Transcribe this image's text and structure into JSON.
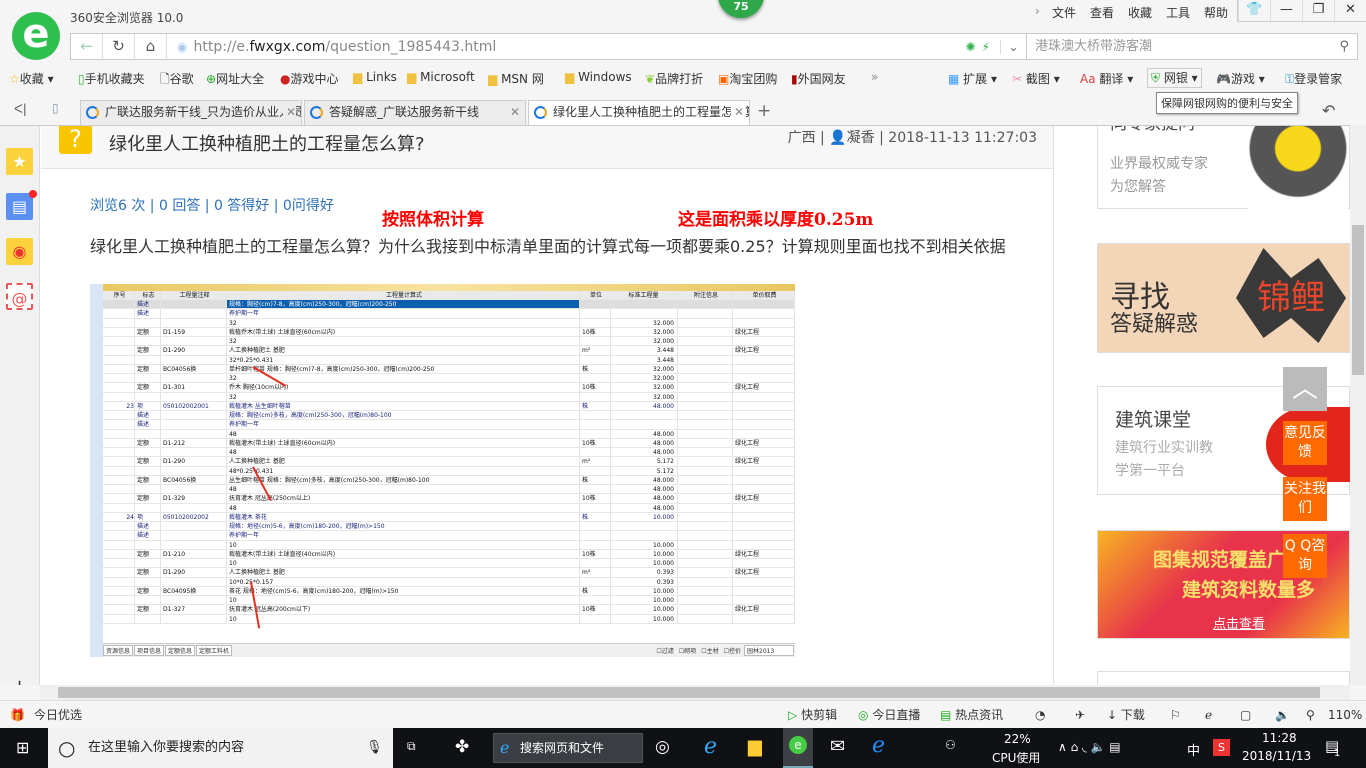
{
  "window": {
    "title": "360安全浏览器 10.0",
    "badge": "75",
    "menu": [
      "文件",
      "查看",
      "收藏",
      "工具",
      "帮助"
    ],
    "menu_arrow": "›"
  },
  "address": {
    "prefix": "http://e.",
    "domain": "fwxgx.com",
    "path": "/question_1985443.html"
  },
  "search": {
    "placeholder": "港珠澳大桥带游客潮"
  },
  "bookmarks": [
    "收藏",
    "手机收藏夹",
    "谷歌",
    "网址大全",
    "游戏中心",
    "Links",
    "Microsoft",
    "MSN 网",
    "Windows",
    "品牌打折",
    "淘宝团购",
    "外国网友"
  ],
  "extensions": [
    "扩展",
    "截图",
    "翻译",
    "网银",
    "游戏",
    "登录管家"
  ],
  "tooltip": "保障网银网购的便利与安全",
  "tabs": [
    {
      "label": "广联达服务新干线_只为造价从业人员"
    },
    {
      "label": "答疑解惑_广联达服务新干线"
    },
    {
      "label": "绿化里人工换种植肥土的工程量怎么算"
    }
  ],
  "question": {
    "title": "绿化里人工换种植肥土的工程量怎么算?",
    "region": "广西",
    "user": "凝香",
    "time": "2018-11-13 11:27:03",
    "stats": "浏览6 次 | 0 回答 | 0 答得好 | 0问得好",
    "body": "绿化里人工换种植肥土的工程量怎么算？为什么我接到中标清单里面的计算式每一项都要乘0.25？计算规则里面也找不到相关依据",
    "annotation1": "按照体积计算",
    "annotation2": "这是面积乘以厚度0.25m"
  },
  "grid": {
    "headers": [
      "序号",
      "标志",
      "工程量注释",
      "工程量计算式",
      "单位",
      "标准工程量",
      "附注信息",
      "单价取费"
    ],
    "rows": [
      [
        "",
        "描述",
        "",
        "规格：胸径(cm)7-8，高度(cm)250-300，冠幅(cm)200-250",
        "",
        "",
        "",
        ""
      ],
      [
        "",
        "描述",
        "",
        "养护期一年",
        "",
        "",
        "",
        ""
      ],
      [
        "",
        "",
        "",
        "32",
        "",
        "32.000",
        "",
        ""
      ],
      [
        "",
        "定额",
        "D1-159",
        "栽植乔木(带土球) 土球直径(60cm以内)",
        "10株",
        "32.000",
        "",
        "绿化工程"
      ],
      [
        "",
        "",
        "",
        "32",
        "",
        "32.000",
        "",
        ""
      ],
      [
        "",
        "定额",
        "D1-290",
        "人工换种植肥土 基肥",
        "m²",
        "3.448",
        "",
        "绿化工程"
      ],
      [
        "",
        "",
        "",
        "32*0.25*0.431",
        "",
        "3.448",
        "",
        ""
      ],
      [
        "",
        "定额",
        "BC04056换",
        "单杆细叶榕苗 规格：胸径(cm)7-8，高度(cm)250-300，冠幅(cm)200-250",
        "株",
        "32.000",
        "",
        ""
      ],
      [
        "",
        "",
        "",
        "32",
        "",
        "32.000",
        "",
        ""
      ],
      [
        "",
        "定额",
        "D1-301",
        "乔木 胸径(10cm以内)",
        "10株",
        "32.000",
        "",
        "绿化工程"
      ],
      [
        "",
        "",
        "",
        "32",
        "",
        "32.000",
        "",
        ""
      ],
      [
        "23",
        "项",
        "050102002001",
        "栽植灌木 丛生细叶榕苗",
        "株",
        "48.000",
        "",
        ""
      ],
      [
        "",
        "描述",
        "",
        "规格：胸径(cm)多枝，高度(cm)250-300，冠幅(m)80-100",
        "",
        "",
        "",
        ""
      ],
      [
        "",
        "描述",
        "",
        "养护期一年",
        "",
        "",
        "",
        ""
      ],
      [
        "",
        "",
        "",
        "48",
        "",
        "48.000",
        "",
        ""
      ],
      [
        "",
        "定额",
        "D1-212",
        "栽植灌木(带土球) 土球直径(60cm以内)",
        "10株",
        "48.000",
        "",
        "绿化工程"
      ],
      [
        "",
        "",
        "",
        "48",
        "",
        "48.000",
        "",
        ""
      ],
      [
        "",
        "定额",
        "D1-290",
        "人工换种植肥土 基肥",
        "m²",
        "5.172",
        "",
        "绿化工程"
      ],
      [
        "",
        "",
        "",
        "48*0.25*0.431",
        "",
        "5.172",
        "",
        ""
      ],
      [
        "",
        "定额",
        "BC04056换",
        "丛生细叶榕苗 规格：胸径(cm)多枝，高度(cm)250-300，冠幅(m)80-100",
        "株",
        "48.000",
        "",
        ""
      ],
      [
        "",
        "",
        "",
        "48",
        "",
        "48.000",
        "",
        ""
      ],
      [
        "",
        "定额",
        "D1-329",
        "抚育灌木 冠丛高(250cm以上)",
        "10株",
        "48.000",
        "",
        "绿化工程"
      ],
      [
        "",
        "",
        "",
        "48",
        "",
        "48.000",
        "",
        ""
      ],
      [
        "24",
        "项",
        "050102002002",
        "栽植灌木 茶花",
        "株",
        "10.000",
        "",
        ""
      ],
      [
        "",
        "描述",
        "",
        "规格：地径(cm)5-6，高度(cm)180-200，冠幅(m)>150",
        "",
        "",
        "",
        ""
      ],
      [
        "",
        "描述",
        "",
        "养护期一年",
        "",
        "",
        "",
        ""
      ],
      [
        "",
        "",
        "",
        "10",
        "",
        "10.000",
        "",
        ""
      ],
      [
        "",
        "定额",
        "D1-210",
        "栽植灌木(带土球) 土球直径(40cm以内)",
        "10株",
        "10.000",
        "",
        "绿化工程"
      ],
      [
        "",
        "",
        "",
        "10",
        "",
        "10.000",
        "",
        ""
      ],
      [
        "",
        "定额",
        "D1-290",
        "人工换种植肥土 基肥",
        "m²",
        "0.393",
        "",
        "绿化工程"
      ],
      [
        "",
        "",
        "",
        "10*0.25*0.157",
        "",
        "0.393",
        "",
        ""
      ],
      [
        "",
        "定额",
        "BC04095换",
        "茶花 规格：地径(cm)5-6，高度(cm)180-200，冠幅(m)>150",
        "株",
        "10.000",
        "",
        ""
      ],
      [
        "",
        "",
        "",
        "10",
        "",
        "10.000",
        "",
        ""
      ],
      [
        "",
        "定额",
        "D1-327",
        "抚育灌木 冠丛高(200cm以下)",
        "10株",
        "10.000",
        "",
        "绿化工程"
      ],
      [
        "",
        "",
        "",
        "10",
        "",
        "10.000",
        "",
        ""
      ]
    ],
    "bottom_tabs": [
      "资源信息",
      "项目信息",
      "定额信息",
      "定额工料机"
    ],
    "filters": [
      "过滤",
      "砌项",
      "主材",
      "控价"
    ],
    "library": "园林2013"
  },
  "sidebar": {
    "card1_title": "向专家提问",
    "card1_sub1": "业界最权威专家",
    "card1_sub2": "为您解答",
    "banner2_a": "寻找",
    "banner2_b": "答疑解惑",
    "banner2_c": "锦鲤",
    "card3_title": "建筑课堂",
    "card3_sub1": "建筑行业实训教",
    "card3_sub2": "学第一平台",
    "banner4_a": "图集规范覆盖广",
    "banner4_b": "建筑资料数量多",
    "banner4_c": "点击查看"
  },
  "float": {
    "feedback": "意见反馈",
    "follow": "关注我们",
    "qq": "Q Q咨询"
  },
  "status": {
    "left": "今日优选",
    "items": [
      "快剪辑",
      "今日直播",
      "热点资讯",
      "下载"
    ],
    "zoom": "110%"
  },
  "taskbar": {
    "search": "在这里输入你要搜索的内容",
    "browser_search": "搜索网页和文件",
    "cpu": "22%",
    "cpu_label": "CPU使用",
    "ime": "中",
    "time": "11:28",
    "date": "2018/11/13",
    "notif": "1"
  }
}
